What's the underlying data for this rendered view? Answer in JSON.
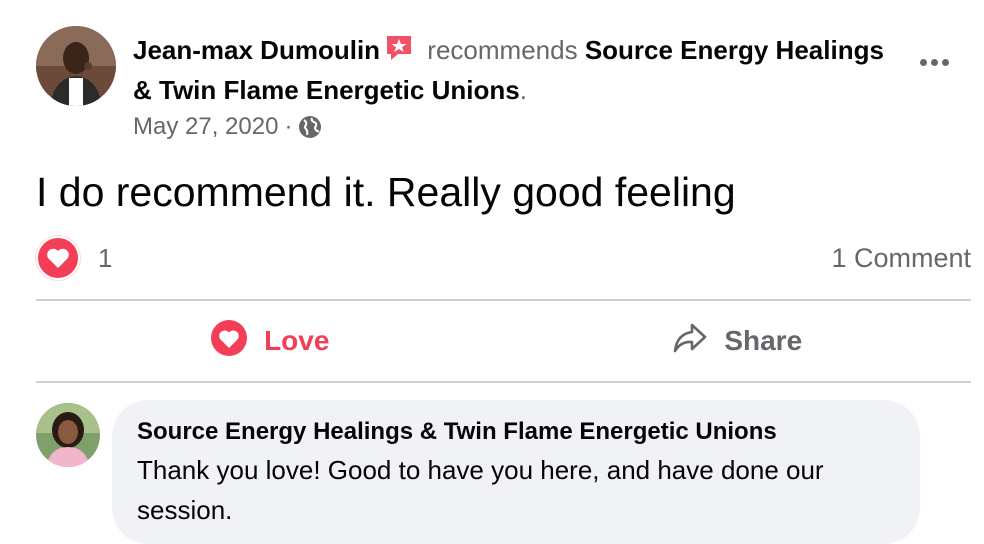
{
  "post": {
    "author": "Jean-max Dumoulin",
    "verb": "recommends",
    "page": "Source Energy Healings & Twin Flame Energetic Unions",
    "period": ".",
    "date": "May 27, 2020",
    "separator": "·",
    "audience_icon": "globe-icon",
    "text": "I do recommend it. Really good feeling"
  },
  "reactions": {
    "icon": "heart-icon",
    "count": "1",
    "comments": "1 Comment"
  },
  "actions": {
    "love_label": "Love",
    "share_label": "Share"
  },
  "comment": {
    "author": "Source Energy Healings & Twin Flame Energetic Unions",
    "text": "Thank you love! Good to have you here, and have done our session."
  },
  "colors": {
    "love": "#f33e58",
    "secondary_text": "#65676b",
    "bubble": "#f0f2f5",
    "divider": "#ced0d4"
  }
}
